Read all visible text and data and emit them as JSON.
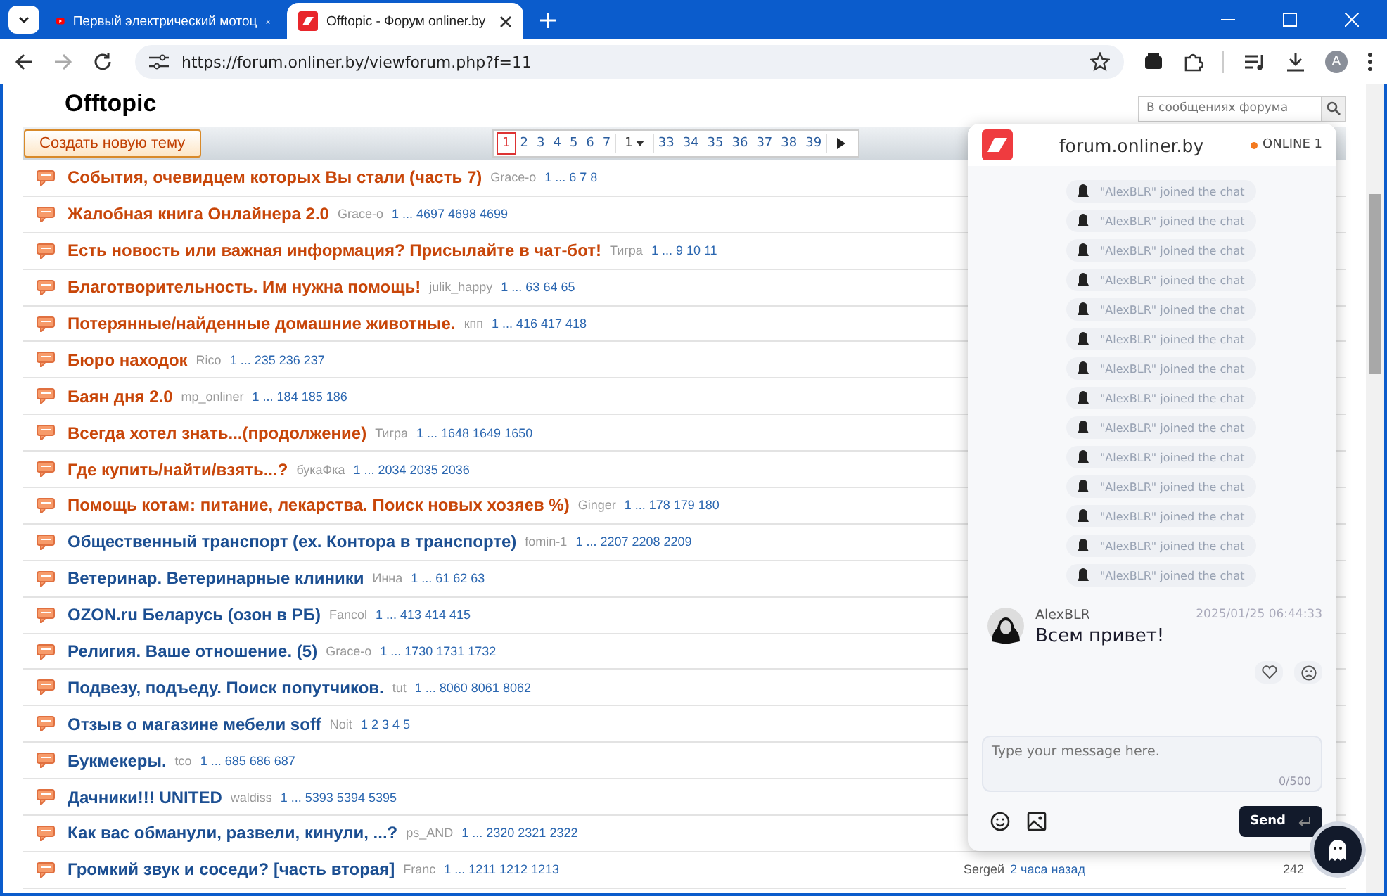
{
  "browser": {
    "tabs": [
      {
        "title": "Первый электрический мотоц",
        "selected": false,
        "kind": "video"
      },
      {
        "title": "Offtopic - Форум onliner.by",
        "selected": true,
        "kind": "site"
      }
    ],
    "url": "https://forum.onliner.by/viewforum.php?f=11",
    "profile": "A"
  },
  "forum": {
    "title": "Offtopic",
    "search": {
      "placeholder": "В сообщениях форума"
    },
    "new_topic_button": "Создать новую тему",
    "pages": [
      {
        "label": "1",
        "kind": "page",
        "selected": true
      },
      {
        "label": "2",
        "kind": "page",
        "selected": false
      },
      {
        "label": "3",
        "kind": "page",
        "selected": false
      },
      {
        "label": "4",
        "kind": "page",
        "selected": false
      },
      {
        "label": "5",
        "kind": "page",
        "selected": false
      },
      {
        "label": "6",
        "kind": "page",
        "selected": false
      },
      {
        "label": "7",
        "kind": "page",
        "selected": false
      },
      {
        "label": "1",
        "kind": "jump"
      },
      {
        "label": "33",
        "kind": "page",
        "selected": false
      },
      {
        "label": "34",
        "kind": "page",
        "selected": false
      },
      {
        "label": "35",
        "kind": "page",
        "selected": false
      },
      {
        "label": "36",
        "kind": "page",
        "selected": false
      },
      {
        "label": "37",
        "kind": "page",
        "selected": false
      },
      {
        "label": "38",
        "kind": "page",
        "selected": false
      },
      {
        "label": "39",
        "kind": "page",
        "selected": false
      },
      {
        "kind": "next"
      }
    ],
    "topics": [
      {
        "title": "События, очевидцем которых Вы стали (часть 7)",
        "author": "Grace-o",
        "pages": "1 ... 6 7 8",
        "hot": true
      },
      {
        "title": "Жалобная книга Онлайнера 2.0",
        "author": "Grace-o",
        "pages": "1 ... 4697 4698 4699",
        "hot": true
      },
      {
        "title": "Есть новость или важная информация? Присылайте в чат-бот!",
        "author": "Тигра",
        "pages": "1 ... 9 10 11",
        "hot": true
      },
      {
        "title": "Благотворительность. Им нужна помощь!",
        "author": "julik_happy",
        "pages": "1 ... 63 64 65",
        "hot": true
      },
      {
        "title": "Потерянные/найденные домашние животные.",
        "author": "кпп",
        "pages": "1 ... 416 417 418",
        "hot": true
      },
      {
        "title": "Бюро находок",
        "author": "Rico",
        "pages": "1 ... 235 236 237",
        "hot": true
      },
      {
        "title": "Баян дня 2.0",
        "author": "mp_onliner",
        "pages": "1 ... 184 185 186",
        "hot": true
      },
      {
        "title": "Всегда хотел знать...(продолжение)",
        "author": "Тигра",
        "pages": "1 ... 1648 1649 1650",
        "hot": true
      },
      {
        "title": "Где купить/найти/взять...?",
        "author": "букаФка",
        "pages": "1 ... 2034 2035 2036",
        "hot": true
      },
      {
        "title": "Помощь котам: питание, лекарства. Поиск новых хозяев %)",
        "author": "Ginger",
        "pages": "1 ... 178 179 180",
        "hot": true
      },
      {
        "title": "Общественный транспорт (ex. Контора в транспорте)",
        "author": "fomin-1",
        "pages": "1 ... 2207 2208 2209",
        "hot": false
      },
      {
        "title": "Ветеринар. Ветеринарные клиники",
        "author": "Инна",
        "pages": "1 ... 61 62 63",
        "hot": false
      },
      {
        "title": "OZON.ru Беларусь (озон в РБ)",
        "author": "Fancol",
        "pages": "1 ... 413 414 415",
        "hot": false
      },
      {
        "title": "Религия. Ваше отношение. (5)",
        "author": "Grace-o",
        "pages": "1 ... 1730 1731 1732",
        "hot": false
      },
      {
        "title": "Подвезу, подъеду. Поиск попутчиков.",
        "author": "tut",
        "pages": "1 ... 8060 8061 8062",
        "hot": false
      },
      {
        "title": "Отзыв о магазине мебели soff",
        "author": "Noit",
        "pages": "1 2 3 4 5",
        "hot": false
      },
      {
        "title": "Букмекеры.",
        "author": "tco",
        "pages": "1 ... 685 686 687",
        "hot": false
      },
      {
        "title": "Дачники!!! UNITED",
        "author": "waldiss",
        "pages": "1 ... 5393 5394 5395",
        "hot": false
      },
      {
        "title": "Как вас обманули, развели, кинули, ...?",
        "author": "ps_AND",
        "pages": "1 ... 2320 2321 2322",
        "hot": false
      },
      {
        "title": "Громкий звук и соседи? [часть вторая]",
        "author": "Franc",
        "pages": "1 ... 1211 1212 1213",
        "hot": false,
        "last_user": "Sergeй",
        "last_time": "2 часа назад",
        "replies": "242"
      }
    ]
  },
  "chat": {
    "site": "forum.onliner.by",
    "online": "ONLINE 1",
    "events": [
      "\"AlexBLR\" joined the chat",
      "\"AlexBLR\" joined the chat",
      "\"AlexBLR\" joined the chat",
      "\"AlexBLR\" joined the chat",
      "\"AlexBLR\" joined the chat",
      "\"AlexBLR\" joined the chat",
      "\"AlexBLR\" joined the chat",
      "\"AlexBLR\" joined the chat",
      "\"AlexBLR\" joined the chat",
      "\"AlexBLR\" joined the chat",
      "\"AlexBLR\" joined the chat",
      "\"AlexBLR\" joined the chat",
      "\"AlexBLR\" joined the chat",
      "\"AlexBLR\" joined the chat"
    ],
    "message": {
      "user": "AlexBLR",
      "time": "2025/01/25 06:44:33",
      "text": "Всем привет!"
    },
    "input": {
      "placeholder": "Type your message here.",
      "counter": "0/500"
    },
    "send": "Send"
  }
}
